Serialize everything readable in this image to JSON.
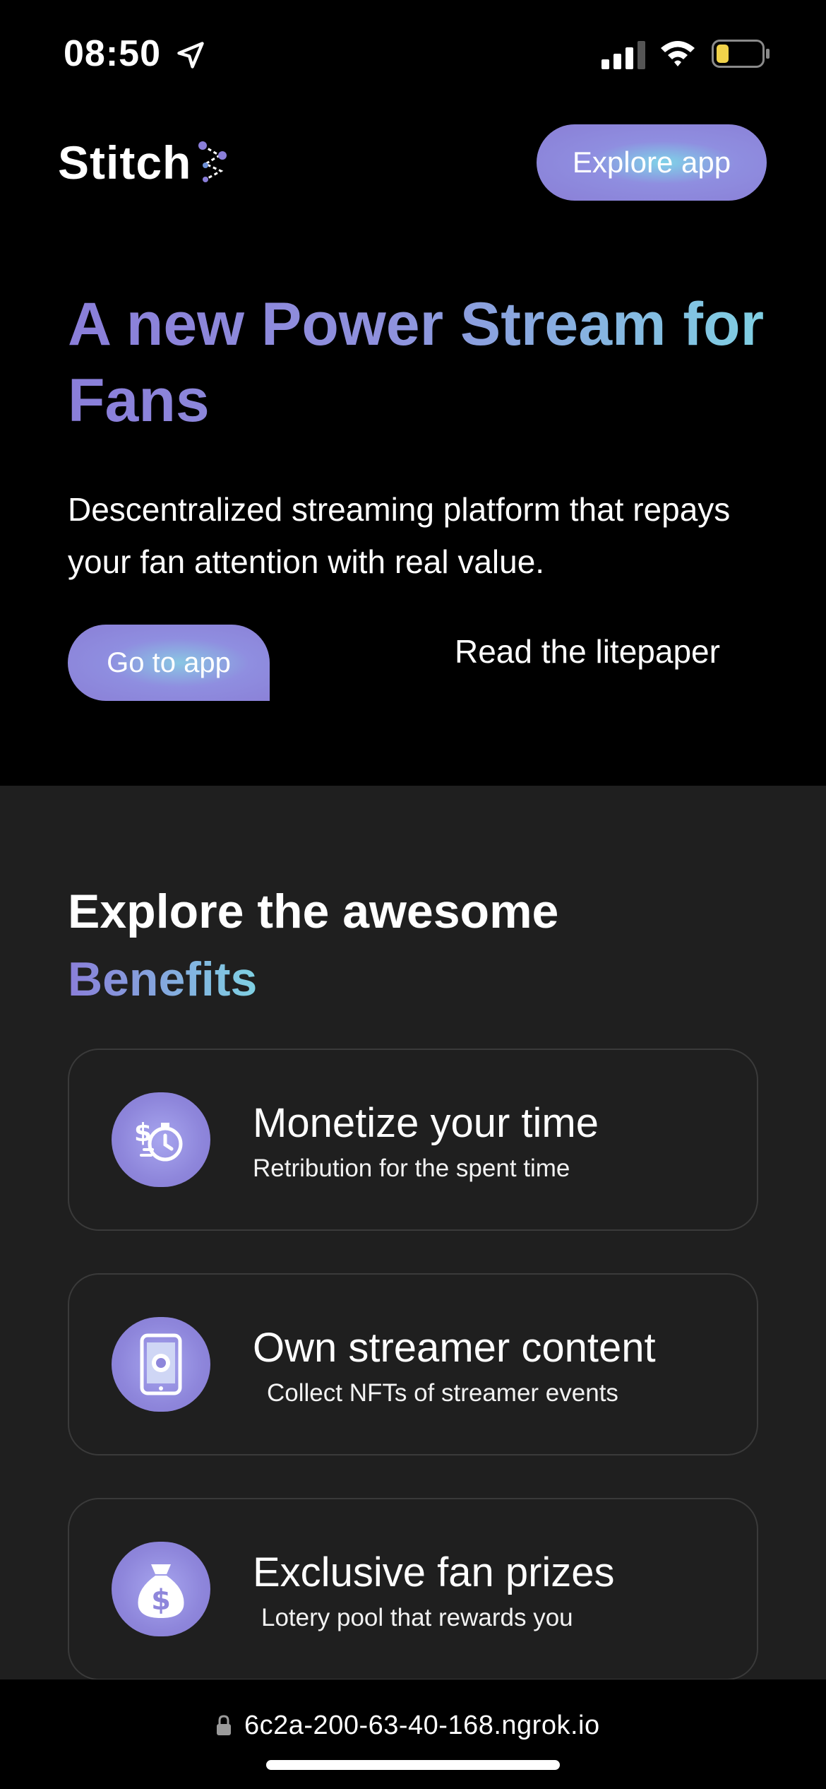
{
  "status_bar": {
    "time": "08:50",
    "icons": [
      "location-arrow-icon",
      "cellular-signal-icon",
      "wifi-icon",
      "battery-icon"
    ]
  },
  "header": {
    "logo_text": "Stitch",
    "explore_button": "Explore app"
  },
  "hero": {
    "title": "A new Power Stream for Fans",
    "subtitle": "Descentralized streaming platform that repays your fan attention with real value.",
    "primary_button": "Go to app",
    "secondary_link": "Read the litepaper"
  },
  "benefits": {
    "title_line1": "Explore the awesome",
    "title_line2": "Benefits",
    "cards": [
      {
        "title": "Monetize your time",
        "subtitle": "Retribution for the spent time",
        "icon": "money-clock-icon"
      },
      {
        "title": "Own streamer content",
        "subtitle": "Collect NFTs of streamer events",
        "icon": "phone-record-icon"
      },
      {
        "title": "Exclusive fan prizes",
        "subtitle": "Lotery pool that rewards you",
        "icon": "money-bag-icon"
      }
    ]
  },
  "browser": {
    "url": "6c2a-200-63-40-168.ngrok.io"
  },
  "colors": {
    "accent_purple": "#8a7ed9",
    "accent_cyan": "#7fd1e3",
    "section_bg": "#1f1f1f",
    "battery_level": "#f2d34a"
  }
}
